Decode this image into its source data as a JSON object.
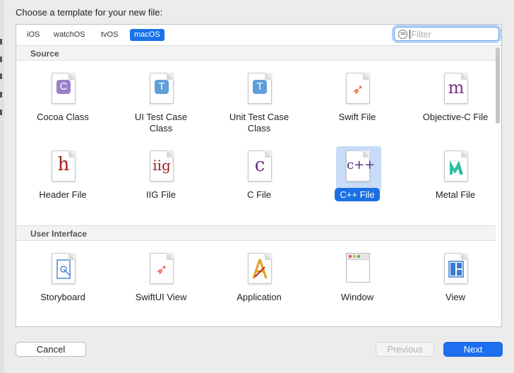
{
  "dialog": {
    "title": "Choose a template for your new file:"
  },
  "tabs": [
    {
      "label": "iOS",
      "active": false
    },
    {
      "label": "watchOS",
      "active": false
    },
    {
      "label": "tvOS",
      "active": false
    },
    {
      "label": "macOS",
      "active": true
    }
  ],
  "filter": {
    "placeholder": "Filter",
    "value": ""
  },
  "sections": {
    "source": {
      "title": "Source",
      "items": [
        {
          "label": "Cocoa Class",
          "icon": "cocoa-class-icon",
          "glyph": "C",
          "color": "#9a7fc9"
        },
        {
          "label": "UI Test Case Class",
          "icon": "ui-test-case-icon",
          "glyph": "T",
          "color": "#5f9fd6"
        },
        {
          "label": "Unit Test Case Class",
          "icon": "unit-test-case-icon",
          "glyph": "T",
          "color": "#5f9fd6"
        },
        {
          "label": "Swift File",
          "icon": "swift-icon",
          "glyph": "✈",
          "color": "#f05138"
        },
        {
          "label": "Objective-C File",
          "icon": "objective-c-icon",
          "glyph": "m",
          "color": "#7b2f8a"
        },
        {
          "label": "Header File",
          "icon": "header-file-icon",
          "glyph": "h",
          "color": "#a11d1d"
        },
        {
          "label": "IIG File",
          "icon": "iig-file-icon",
          "glyph": "iig",
          "color": "#a11d1d"
        },
        {
          "label": "C File",
          "icon": "c-file-icon",
          "glyph": "c",
          "color": "#6a2c86"
        },
        {
          "label": "C++ File",
          "icon": "cpp-file-icon",
          "glyph": "c++",
          "color": "#4d2980",
          "selected": true
        },
        {
          "label": "Metal File",
          "icon": "metal-icon",
          "glyph": "M",
          "color": "#2bbfa4"
        }
      ]
    },
    "ui": {
      "title": "User Interface",
      "items": [
        {
          "label": "Storyboard",
          "icon": "storyboard-icon"
        },
        {
          "label": "SwiftUI View",
          "icon": "swiftui-icon"
        },
        {
          "label": "Application",
          "icon": "application-icon"
        },
        {
          "label": "Window",
          "icon": "window-icon"
        },
        {
          "label": "View",
          "icon": "view-icon"
        }
      ]
    }
  },
  "buttons": {
    "cancel": "Cancel",
    "previous": "Previous",
    "next": "Next"
  }
}
